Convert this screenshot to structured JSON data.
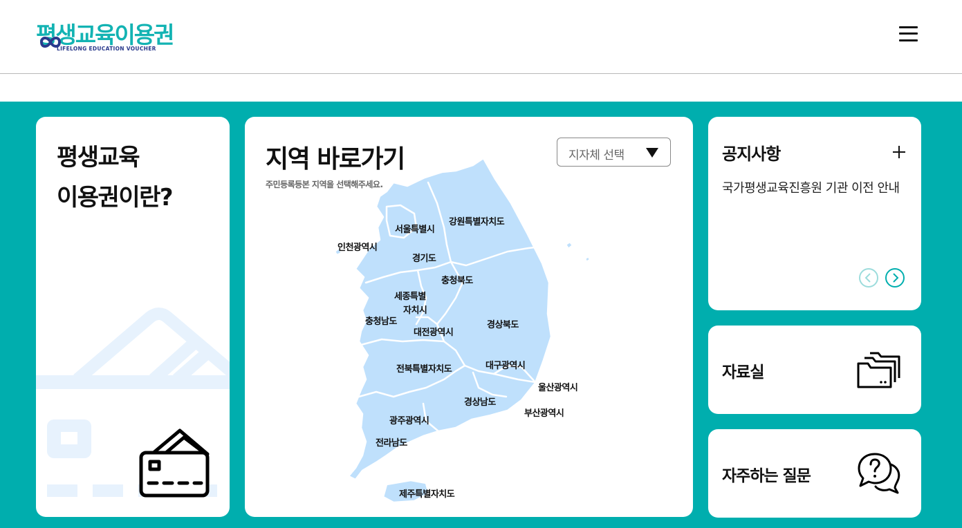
{
  "header": {
    "logo_text": "평생교육이용권",
    "logo_subtext": "LIFELONG EDUCATION VOUCHER",
    "menu_icon": "hamburger-menu-icon"
  },
  "colors": {
    "accent": "#00aeae",
    "logo_teal": "#13b3b3",
    "logo_navy": "#2a3a8c",
    "map_fill": "#bfe0fc"
  },
  "about_card": {
    "title_line1": "평생교육",
    "title_line2": "이용권이란?",
    "icon": "voucher-card-icon"
  },
  "region_card": {
    "title": "지역 바로가기",
    "subtitle": "주민등록등본 지역을 선택해주세요.",
    "select_value": "지자체 선택",
    "regions": [
      "서울특별시",
      "강원특별자치도",
      "인천광역시",
      "경기도",
      "충청북도",
      "세종특별",
      "자치시",
      "충청남도",
      "대전광역시",
      "경상북도",
      "대구광역시",
      "전북특별자치도",
      "울산광역시",
      "경상남도",
      "부산광역시",
      "광주광역시",
      "전라남도",
      "제주특별자치도"
    ]
  },
  "notice_card": {
    "title": "공지사항",
    "item": "국가평생교육진흥원 기관 이전 안내"
  },
  "archive_card": {
    "title": "자료실",
    "icon": "folder-icon"
  },
  "faq_card": {
    "title": "자주하는 질문",
    "icon": "question-chat-icon"
  }
}
